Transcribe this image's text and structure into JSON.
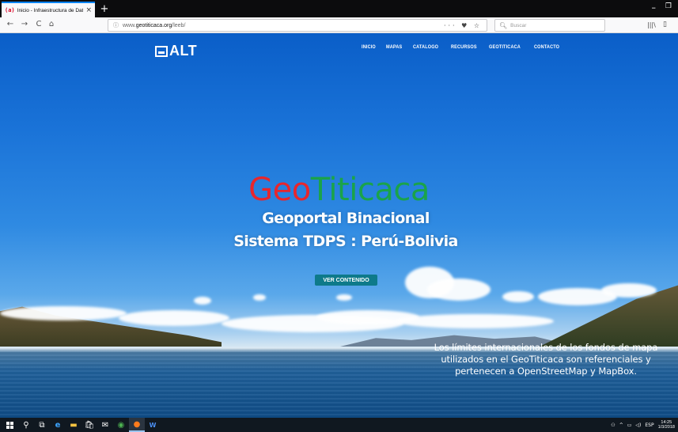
{
  "browser": {
    "tab": {
      "favicon": "(a)",
      "title": "Inicio - Infraestructura de Dato",
      "close": "×"
    },
    "new_tab": "+",
    "window": {
      "minimize": "–",
      "restore": "❐"
    },
    "nav": {
      "back": "←",
      "forward": "→",
      "reload": "C",
      "home": "⌂"
    },
    "url": {
      "prefix": "www.",
      "domain": "geotiticaca.org",
      "path": "/leeb/"
    },
    "url_actions": "··· ♥ ☆",
    "search_placeholder": "Buscar"
  },
  "site": {
    "logo": "ALT",
    "menu": [
      "INICIO",
      "MAPAS",
      "CATALOGO",
      "RECURSOS",
      "GEOTITICACA",
      "CONTACTO"
    ],
    "hero": {
      "title_part1": "Geo",
      "title_part2": "Titicaca",
      "subtitle1": "Geoportal Binacional",
      "subtitle2": "Sistema TDPS : Perú-Bolivia",
      "cta": "VER CONTENIDO"
    },
    "notice": {
      "line1": "Los límites internacionales de los fondos de mapa",
      "line2": "utilizados en el GeoTiticaca son referenciales y",
      "line3": "pertenecen a OpenStreetMap y MapBox."
    },
    "colors": {
      "geo": "#e8262c",
      "titicaca": "#1aa34a",
      "cta": "#0e7a8a"
    }
  },
  "taskbar": {
    "icons": [
      "start-icon",
      "search-icon",
      "task-view-icon",
      "edge-icon",
      "file-explorer-icon",
      "store-icon",
      "mail-icon",
      "chrome-icon",
      "firefox-icon",
      "word-icon"
    ],
    "tray": {
      "lang": "ESP",
      "time": "14:25",
      "date": "1/3/2018"
    }
  }
}
